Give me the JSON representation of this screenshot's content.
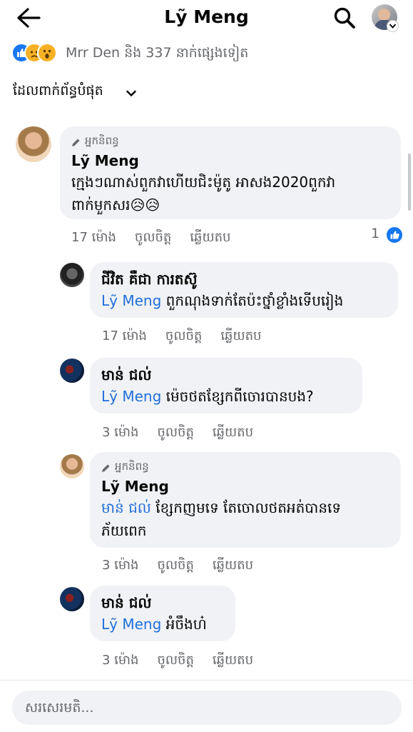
{
  "header": {
    "title": "Lỹ Meng",
    "back_icon": "arrow-left-icon",
    "search_icon": "search-icon"
  },
  "reactions": {
    "icons": [
      "like",
      "sad",
      "wow"
    ],
    "summary": "Mrr Den និង 337 នាក់ផ្សេងទៀត"
  },
  "sort": {
    "label": "ដែលពាក់ព័ន្ធបំផុត"
  },
  "colors": {
    "accent": "#1877f2",
    "mention": "#216fdb",
    "bubble": "#f0f2f5",
    "meta": "#65676b"
  },
  "comments": [
    {
      "badge": "អ្នកនិពន្ធ",
      "author": "Lỹ Meng",
      "text": "ក្មេងៗណាស់ពួកវាហើយជិះម៉ូតូ អាសង2020ពួកវាពាក់មួកសរ😥😥",
      "time": "17 ម៉ោង",
      "like": "ចូលចិត្ត",
      "reply": "ឆ្លើយតប",
      "reaction_count": "1"
    },
    {
      "author": "ជីវិត គឺជា ការតស៊ូ",
      "mention": "Lỹ Meng",
      "text": "ពួកណុងទាក់តែប៉ះថ្នាំខ្លាំងទើបរៀង",
      "time": "17 ម៉ោង",
      "like": "ចូលចិត្ត",
      "reply": "ឆ្លើយតប"
    },
    {
      "author": "មាន់ ជល់",
      "mention": "Lỹ Meng",
      "text": "ម៉េចថតខ្សែកពីចោរបានបង?",
      "time": "3 ម៉ោង",
      "like": "ចូលចិត្ត",
      "reply": "ឆ្លើយតប"
    },
    {
      "badge": "អ្នកនិពន្ធ",
      "author": "Lỹ Meng",
      "mention": "មាន់ ជល់",
      "text_line1": "ខ្សែកញមទេ តែចោលថតអត់បានទេ",
      "text_line2": "ភ័យពេក",
      "time": "3 ម៉ោង",
      "like": "ចូលចិត្ត",
      "reply": "ឆ្លើយតប"
    },
    {
      "author": "មាន់ ជល់",
      "mention": "Lỹ Meng",
      "text": "អំចឹងហ៎",
      "time": "3 ម៉ោង",
      "like": "ចូលចិត្ត",
      "reply": "ឆ្លើយតប"
    }
  ],
  "footer": {
    "placeholder": "សរសេរមតិ..."
  }
}
